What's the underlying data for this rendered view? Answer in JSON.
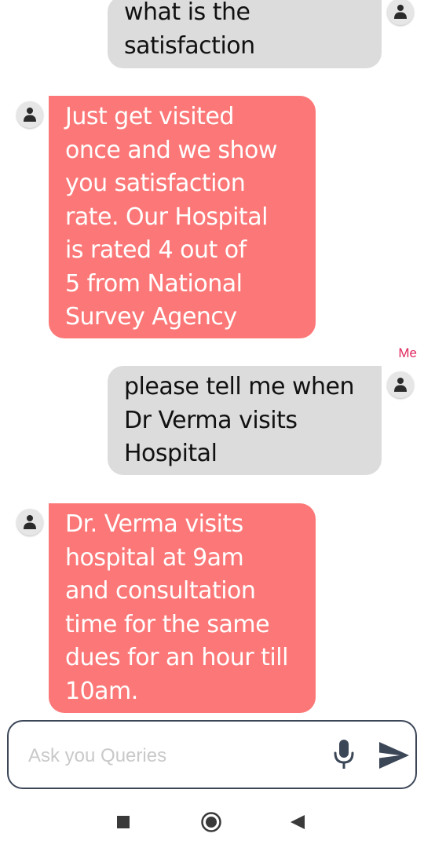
{
  "messages": [
    {
      "sender": "user",
      "text": "what is the\nsatisfaction"
    },
    {
      "sender": "bot",
      "text": "Just get visited\nonce and we show\nyou satisfaction\nrate. Our Hospital\nis rated 4 out of\n5 from National\nSurvey Agency"
    },
    {
      "sender": "user",
      "label": "Me",
      "text": "please tell me when\nDr Verma visits\nHospital"
    },
    {
      "sender": "bot",
      "text": "Dr. Verma visits\nhospital at 9am\nand consultation\ntime for the same\ndues for an hour till\n10am."
    }
  ],
  "input": {
    "placeholder": "Ask you Queries",
    "value": ""
  },
  "icons": {
    "avatar": "person-icon",
    "mic": "microphone-icon",
    "send": "send-icon",
    "nav": [
      "recents-square-icon",
      "home-circle-icon",
      "back-triangle-icon"
    ]
  },
  "colors": {
    "user_bubble": "#dcdcdc",
    "bot_bubble": "#fc7878",
    "sender_label": "#e0285f",
    "input_border": "#3b4657",
    "icon_dark": "#3b4657"
  }
}
